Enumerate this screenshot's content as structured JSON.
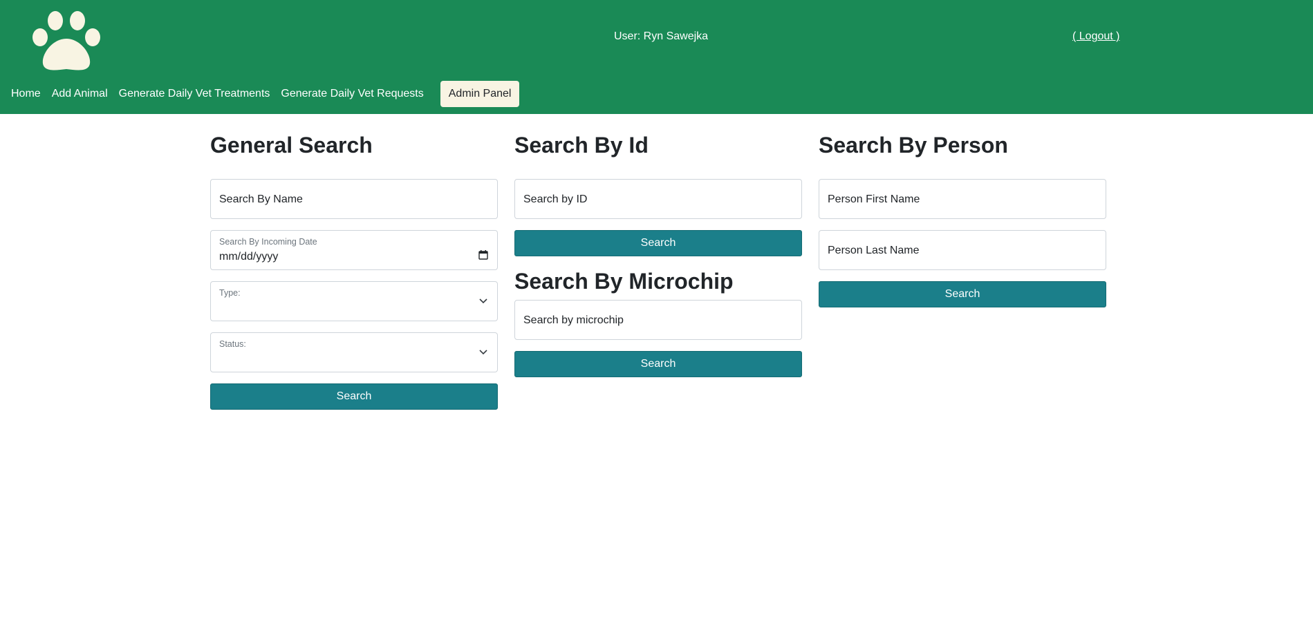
{
  "header": {
    "logo_icon": "paw-print-icon",
    "user_text": "User: Ryn Sawejka",
    "logout_label": "( Logout )",
    "brand_color": "#1a8a56"
  },
  "nav": {
    "items": [
      {
        "label": "Home"
      },
      {
        "label": "Add Animal"
      },
      {
        "label": "Generate Daily Vet Treatments"
      },
      {
        "label": "Generate Daily Vet Requests"
      }
    ],
    "admin_label": "Admin Panel"
  },
  "general_search": {
    "title": "General Search",
    "name_placeholder": "Search By Name",
    "date_label": "Search By Incoming Date",
    "date_value": "mm/dd/yyyy",
    "type_label": "Type:",
    "status_label": "Status:",
    "search_label": "Search"
  },
  "search_by_id": {
    "title": "Search By Id",
    "placeholder": "Search by ID",
    "search_label": "Search"
  },
  "search_by_microchip": {
    "title": "Search By Microchip",
    "placeholder": "Search by microchip",
    "search_label": "Search"
  },
  "search_by_person": {
    "title": "Search By Person",
    "first_placeholder": "Person First Name",
    "last_placeholder": "Person Last Name",
    "search_label": "Search"
  },
  "colors": {
    "button": "#1b7f8a",
    "admin_button_bg": "#f8f4e3"
  }
}
